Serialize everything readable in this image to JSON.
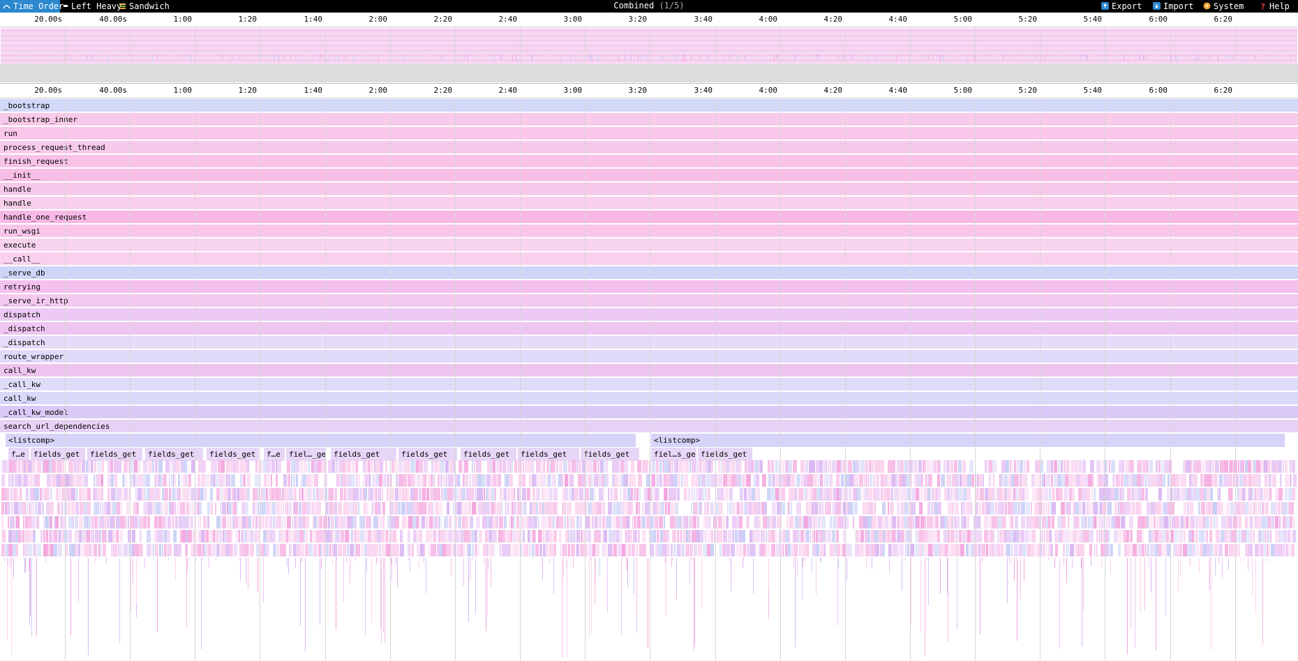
{
  "toolbar": {
    "views": [
      {
        "label": "Time Order",
        "icon": "time-order-icon",
        "active": true
      },
      {
        "label": "Left Heavy",
        "icon": "left-heavy-icon",
        "active": false
      },
      {
        "label": "Sandwich",
        "icon": "sandwich-icon",
        "active": false
      }
    ],
    "title": "Combined",
    "title_sub": "(1/5)",
    "actions": [
      {
        "label": "Export",
        "icon": "export-icon"
      },
      {
        "label": "Import",
        "icon": "import-icon"
      },
      {
        "label": "System",
        "icon": "system-icon"
      },
      {
        "label": "Help",
        "icon": "help-icon"
      }
    ]
  },
  "ruler_ticks": [
    "20.00s",
    "40.00s",
    "1:00",
    "1:20",
    "1:40",
    "2:00",
    "2:20",
    "2:40",
    "3:00",
    "3:20",
    "3:40",
    "4:00",
    "4:20",
    "4:40",
    "5:00",
    "5:20",
    "5:40",
    "6:00",
    "6:20"
  ],
  "frames": [
    {
      "name": "_bootstrap",
      "color": "#d1d8f8"
    },
    {
      "name": "_bootstrap_inner",
      "color": "#f9c9e9"
    },
    {
      "name": "run",
      "color": "#fac7ea"
    },
    {
      "name": "process_request_thread",
      "color": "#f7c9ea"
    },
    {
      "name": "finish_request",
      "color": "#f9c3e7"
    },
    {
      "name": "__init__",
      "color": "#f8bee5"
    },
    {
      "name": "handle",
      "color": "#f8c8ea"
    },
    {
      "name": "handle",
      "color": "#f8d0eb"
    },
    {
      "name": "handle_one_request",
      "color": "#f8b8e5"
    },
    {
      "name": "run_wsgi",
      "color": "#f9c6ea"
    },
    {
      "name": "execute",
      "color": "#f8d3ee"
    },
    {
      "name": "__call__",
      "color": "#f9d1ee"
    },
    {
      "name": "_serve_db",
      "color": "#d0d5f8"
    },
    {
      "name": "retrying",
      "color": "#f4c0ee"
    },
    {
      "name": "_serve_ir_http",
      "color": "#f3c9f0"
    },
    {
      "name": "dispatch",
      "color": "#eccaf4"
    },
    {
      "name": "_dispatch",
      "color": "#efc6f1"
    },
    {
      "name": "_dispatch",
      "color": "#e4dcf8"
    },
    {
      "name": "route_wrapper",
      "color": "#e1d9f9"
    },
    {
      "name": "call_kw",
      "color": "#edc4ee"
    },
    {
      "name": "_call_kw",
      "color": "#dfdcf9"
    },
    {
      "name": "call_kw",
      "color": "#dbd9f9"
    },
    {
      "name": "_call_kw_model",
      "color": "#dcc8f7"
    },
    {
      "name": "search_url_dependencies",
      "color": "#e7d1f5"
    }
  ],
  "listcomp_row": [
    {
      "name": "<listcomp>",
      "color": "#d6d4f8"
    },
    {
      "name": "<listcomp>",
      "color": "#d6d4f8"
    }
  ],
  "fields_row": [
    {
      "name": "f…e",
      "color": "#e7d6f6"
    },
    {
      "name": "fields_get",
      "color": "#e7d6f6"
    },
    {
      "name": "fields_get",
      "color": "#e7d6f6"
    },
    {
      "name": "fields_get",
      "color": "#e7d6f6"
    },
    {
      "name": "fields_get",
      "color": "#e7d6f6"
    },
    {
      "name": "f…e",
      "color": "#e7d6f6"
    },
    {
      "name": "fiel…_ge",
      "color": "#e7d6f6"
    },
    {
      "name": "fields_get",
      "color": "#e7d6f6"
    },
    {
      "name": "fields_get",
      "color": "#e7d6f6"
    },
    {
      "name": "fields_get",
      "color": "#e7d6f6"
    },
    {
      "name": "fields_get",
      "color": "#e7d6f6"
    },
    {
      "name": "fields_get",
      "color": "#e7d6f6"
    },
    {
      "name": "fiel…s_ge",
      "color": "#e7d6f6"
    },
    {
      "name": "fields_get",
      "color": "#e7d6f6"
    }
  ],
  "colors": {
    "accent": "#2b88ce",
    "toolbar_bg": "#000000",
    "gridline": "#d7d7d7",
    "mark_pink": "#f4a6de",
    "mark_lilac": "#d9b8f3",
    "mark_blue": "#c8cff6"
  }
}
